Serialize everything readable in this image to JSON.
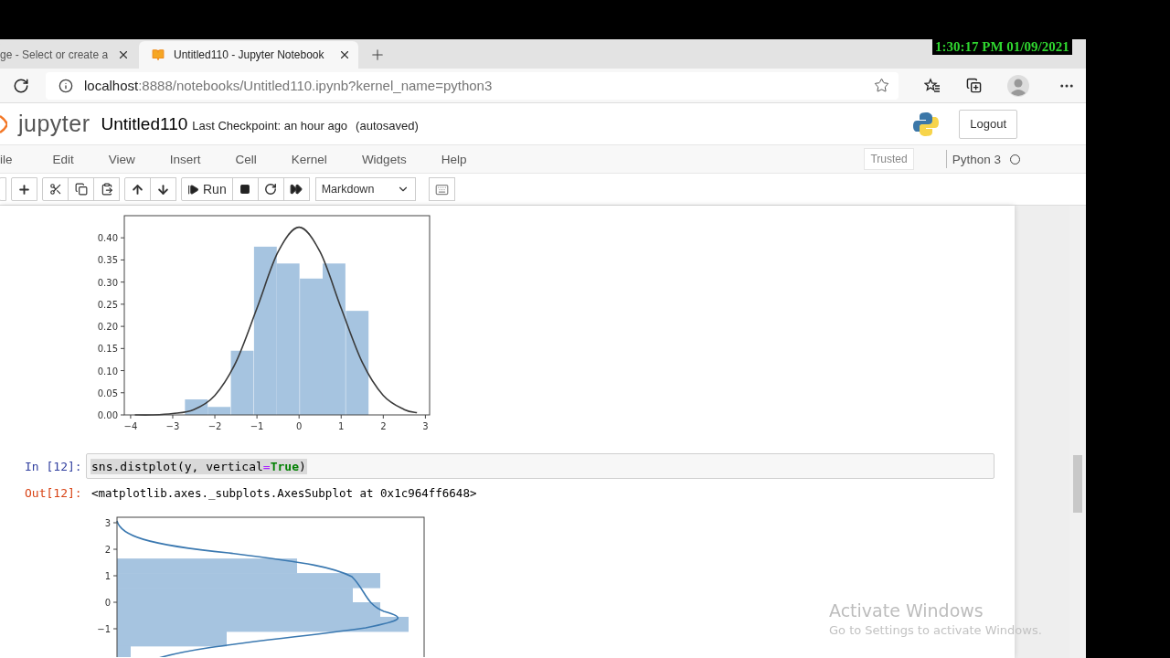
{
  "overlay_clock": "1:30:17 PM 01/09/2021",
  "browser": {
    "tabs": [
      {
        "title": "ge - Select or create a",
        "selected": false
      },
      {
        "title": "Untitled110 - Jupyter Notebook",
        "selected": true
      }
    ],
    "address": {
      "host": "localhost",
      "path": ":8888/notebooks/Untitled110.ipynb?kernel_name=python3"
    }
  },
  "jupyter": {
    "logo_text": "jupyter",
    "notebook_name": "Untitled110",
    "checkpoint": "Last Checkpoint: an hour ago",
    "autosave": "(autosaved)",
    "logout": "Logout",
    "menu": [
      "ile",
      "Edit",
      "View",
      "Insert",
      "Cell",
      "Kernel",
      "Widgets",
      "Help"
    ],
    "trusted": "Trusted",
    "kernel_name": "Python 3",
    "kernel_busy": false,
    "toolbar": {
      "run_label": "Run",
      "cell_type": "Markdown"
    }
  },
  "output_1": {
    "chart_data": {
      "type": "bar",
      "x": [
        -2.44,
        -1.9,
        -1.35,
        -0.8,
        -0.26,
        0.29,
        0.83,
        1.38
      ],
      "series": [
        {
          "color": "#a6c4e0",
          "values": [
            0.035,
            0.018,
            0.145,
            0.38,
            0.342,
            0.308,
            0.342,
            0.235
          ]
        },
        {
          "type": "line",
          "color": "#3a3a3a",
          "x": [
            -3.9,
            -3.5,
            -3,
            -2.5,
            -2,
            -1.5,
            -1,
            -0.5,
            0,
            0.5,
            1,
            1.5,
            2,
            2.5,
            2.8
          ],
          "values": [
            0,
            0,
            0.003,
            0.012,
            0.044,
            0.119,
            0.241,
            0.368,
            0.424,
            0.368,
            0.241,
            0.119,
            0.044,
            0.012,
            0.005
          ]
        }
      ],
      "xlim": [
        -4.15,
        3.1
      ],
      "ylim": [
        0,
        0.45
      ],
      "xticks": [
        {
          "value": -4,
          "label": "−4"
        },
        {
          "value": -3,
          "label": "−3"
        },
        {
          "value": -2,
          "label": "−2"
        },
        {
          "value": -1,
          "label": "−1"
        },
        {
          "value": 0,
          "label": "0"
        },
        {
          "value": 1,
          "label": "1"
        },
        {
          "value": 2,
          "label": "2"
        },
        {
          "value": 3,
          "label": "3"
        }
      ],
      "yticks": [
        {
          "value": 0,
          "label": "0.00"
        },
        {
          "value": 0.05,
          "label": "0.05"
        },
        {
          "value": 0.1,
          "label": "0.10"
        },
        {
          "value": 0.15,
          "label": "0.15"
        },
        {
          "value": 0.2,
          "label": "0.20"
        },
        {
          "value": 0.25,
          "label": "0.25"
        },
        {
          "value": 0.3,
          "label": "0.30"
        },
        {
          "value": 0.35,
          "label": "0.35"
        },
        {
          "value": 0.4,
          "label": "0.40"
        }
      ]
    }
  },
  "cell": {
    "prompt": "In [12]:",
    "selected": true,
    "code": [
      {
        "text": "sns.distplot(y, vertical",
        "kind": "plain"
      },
      {
        "text": "=",
        "kind": "operator"
      },
      {
        "text": "True",
        "kind": "keyword"
      },
      {
        "text": ")",
        "kind": "plain"
      }
    ]
  },
  "output_2": {
    "prompt": "Out[12]:",
    "text": "<matplotlib.axes._subplots.AxesSubplot at 0x1c964ff6648>",
    "yticks": [
      "3",
      "2",
      "1",
      "0",
      "−1"
    ]
  },
  "os_watermark": {
    "title": "Activate Windows",
    "subtitle": "Go to Settings to activate Windows."
  }
}
